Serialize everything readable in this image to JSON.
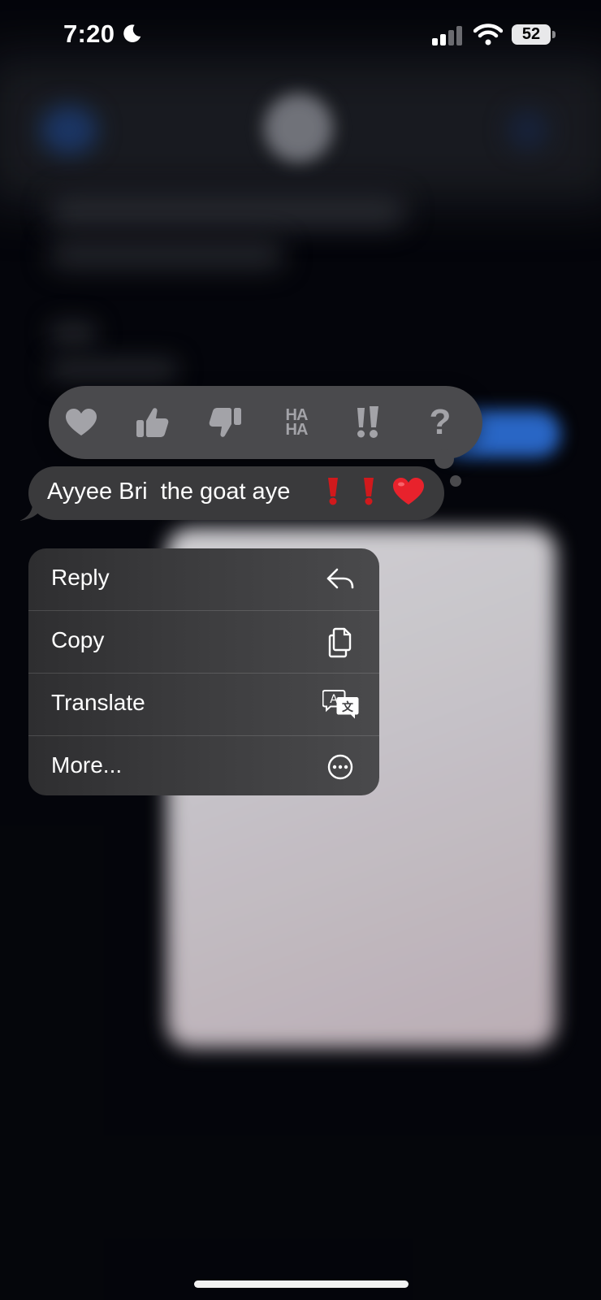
{
  "status_bar": {
    "time": "7:20",
    "battery_percent": "52",
    "focus_icon": "moon-icon",
    "signal_icon": "cellular-signal-icon",
    "wifi_icon": "wifi-icon"
  },
  "reactions": [
    {
      "name": "heart",
      "icon": "heart-icon"
    },
    {
      "name": "thumbs-up",
      "icon": "thumbs-up-icon"
    },
    {
      "name": "thumbs-down",
      "icon": "thumbs-down-icon"
    },
    {
      "name": "haha",
      "icon": "haha-icon",
      "text_top": "HA",
      "text_bottom": "HA"
    },
    {
      "name": "emphasize",
      "icon": "double-exclamation-icon"
    },
    {
      "name": "question",
      "icon": "question-mark-icon",
      "text": "?"
    }
  ],
  "message": {
    "text": "Ayyee Bri  the goat aye",
    "emojis": [
      "❗",
      "❗",
      "❤️"
    ]
  },
  "context_menu": {
    "items": [
      {
        "label": "Reply",
        "icon": "reply-arrow-icon"
      },
      {
        "label": "Copy",
        "icon": "copy-icon"
      },
      {
        "label": "Translate",
        "icon": "translate-icon"
      },
      {
        "label": "More...",
        "icon": "more-ellipsis-icon"
      }
    ]
  },
  "colors": {
    "background": "#05060c",
    "bubble": "#3a3a3c",
    "reaction_bar": "#4a4a4d",
    "reaction_icon": "#a3a3a8",
    "accent_blue": "#2d6fd6"
  }
}
